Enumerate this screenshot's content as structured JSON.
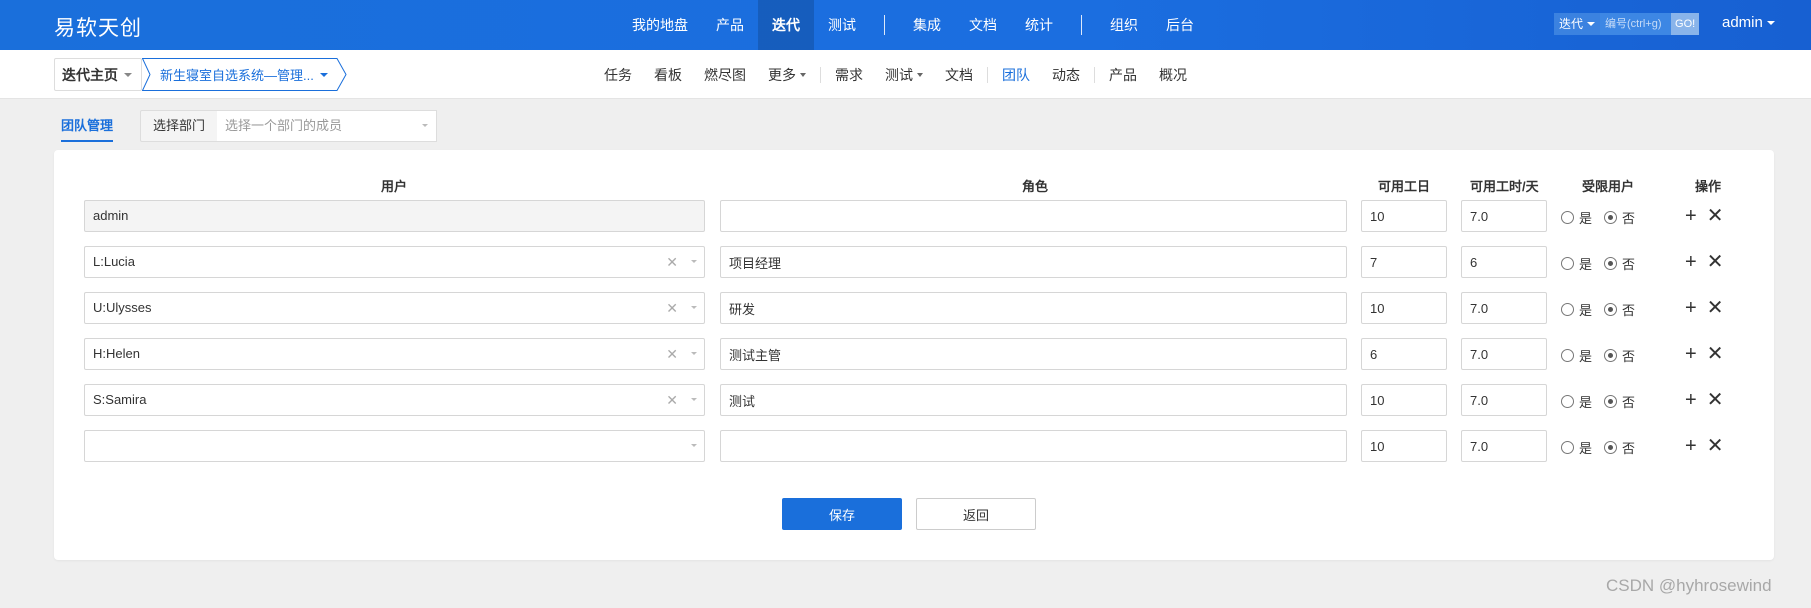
{
  "app": {
    "logo": "易软天创"
  },
  "top_nav": {
    "items": [
      "我的地盘",
      "产品",
      "迭代",
      "测试",
      "集成",
      "文档",
      "统计",
      "组织",
      "后台"
    ],
    "active": "迭代"
  },
  "search": {
    "type": "迭代",
    "placeholder": "编号(ctrl+g)",
    "go": "GO!"
  },
  "user": {
    "name": "admin"
  },
  "breadcrumb": {
    "home": "迭代主页",
    "project": "新生寝室自选系统—管理..."
  },
  "sub_nav": {
    "items": [
      "任务",
      "看板",
      "燃尽图",
      "更多",
      "需求",
      "测试",
      "文档",
      "团队",
      "动态",
      "产品",
      "概况"
    ],
    "active": "团队"
  },
  "filter": {
    "tab": "团队管理",
    "dept_label": "选择部门",
    "dept_placeholder": "选择一个部门的成员"
  },
  "table": {
    "headers": {
      "user": "用户",
      "role": "角色",
      "days": "可用工日",
      "hours": "可用工时/天",
      "limited": "受限用户",
      "ops": "操作"
    },
    "yes": "是",
    "no": "否",
    "rows": [
      {
        "user": "admin",
        "role": "",
        "days": "10",
        "hours": "7.0",
        "limited": false
      },
      {
        "user": "L:Lucia",
        "role": "项目经理",
        "days": "7",
        "hours": "6",
        "limited": false
      },
      {
        "user": "U:Ulysses",
        "role": "研发",
        "days": "10",
        "hours": "7.0",
        "limited": false
      },
      {
        "user": "H:Helen",
        "role": "测试主管",
        "days": "6",
        "hours": "7.0",
        "limited": false
      },
      {
        "user": "S:Samira",
        "role": "测试",
        "days": "10",
        "hours": "7.0",
        "limited": false
      },
      {
        "user": "",
        "role": "",
        "days": "10",
        "hours": "7.0",
        "limited": false
      }
    ]
  },
  "buttons": {
    "save": "保存",
    "back": "返回"
  },
  "watermark": "CSDN @hyhrosewind",
  "colors": {
    "primary": "#1a6fdb",
    "page_bg": "#efefef"
  }
}
